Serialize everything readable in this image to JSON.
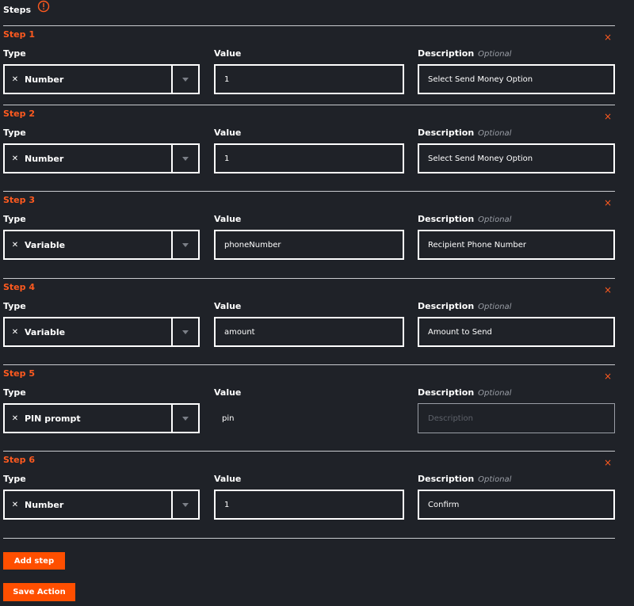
{
  "header": {
    "title": "Steps"
  },
  "fields": {
    "type_label": "Type",
    "value_label": "Value",
    "description_label": "Description",
    "optional_label": "Optional",
    "description_placeholder": "Description"
  },
  "steps": [
    {
      "label": "Step 1",
      "type": "Number",
      "value": "1",
      "description": "Select Send Money Option"
    },
    {
      "label": "Step 2",
      "type": "Number",
      "value": "1",
      "description": "Select Send Money Option"
    },
    {
      "label": "Step 3",
      "type": "Variable",
      "value": "phoneNumber",
      "description": "Recipient Phone Number"
    },
    {
      "label": "Step 4",
      "type": "Variable",
      "value": "amount",
      "description": "Amount to Send"
    },
    {
      "label": "Step 5",
      "type": "PIN prompt",
      "value": "pin",
      "description": ""
    },
    {
      "label": "Step 6",
      "type": "Number",
      "value": "1",
      "description": "Confirm"
    }
  ],
  "actions": {
    "add_step": "Add step",
    "save_action": "Save Action"
  },
  "icons": {
    "info": "info-icon",
    "remove": "close-icon",
    "clear": "clear-icon",
    "dropdown": "chevron-down-icon"
  },
  "colors": {
    "background": "#1f2228",
    "accent": "#ff4f00",
    "text": "#ffffff",
    "muted": "#9a9ea6"
  }
}
